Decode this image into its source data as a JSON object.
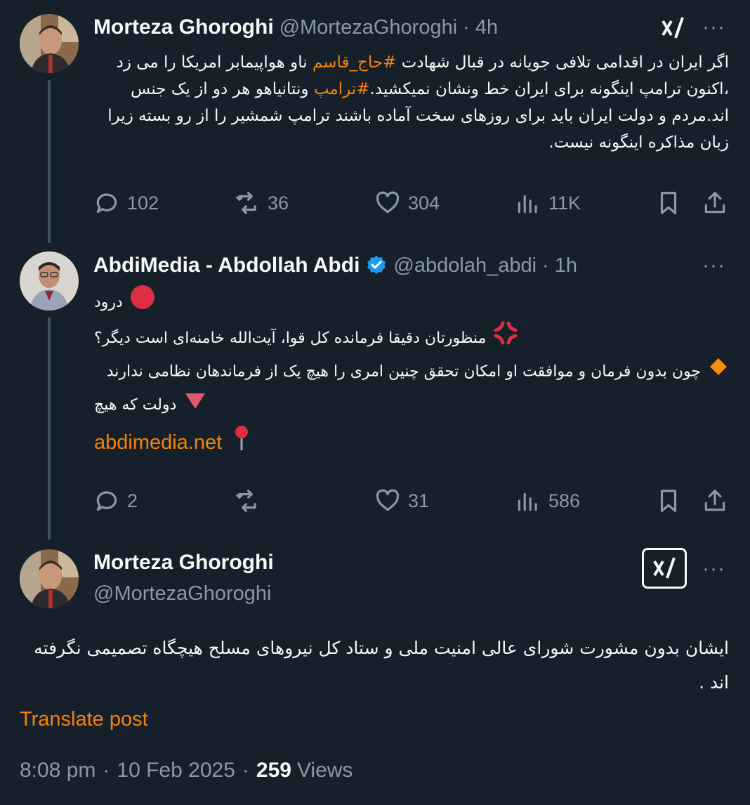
{
  "tweet1": {
    "name": "Morteza Ghoroghi",
    "handle": "@MortezaGhoroghi",
    "time": "4h",
    "text_a": "اگر ایران در اقدامی تلافی جویانه در قبال شهادت ",
    "hashtag_a": "#حاج_قاسم",
    "text_b": " ناو هواپیمابر امریکا را می زد ،اکنون ترامپ اینگونه برای ایران خط ونشان نمیکشید.",
    "hashtag_b": "#ترامپ",
    "text_c": " ونتانیاهو هر دو از یک جنس اند.مردم و دولت ایران باید برای روزهای سخت آماده باشند ترامپ شمشیر را از رو بسته زیرا زبان مذاکره اینگونه نیست.",
    "stats": {
      "replies": "102",
      "reposts": "36",
      "likes": "304",
      "views": "11K"
    }
  },
  "tweet2": {
    "name": "AbdiMedia - Abdollah Abdi",
    "handle": "@abdolah_abdi",
    "time": "1h",
    "line1": "درود",
    "line2": "منظورتان دقیقا فرمانده کل قوا، آیت‌الله خامنه‌ای است دیگر؟",
    "line3": "چون بدون فرمان و موافقت او امکان تحقق چنین امری را هیچ یک از فرماندهان نظامی ندارند",
    "line4": "دولت که هیچ",
    "link": "abdimedia.net",
    "stats": {
      "replies": "2",
      "reposts": "",
      "likes": "31",
      "views": "586"
    }
  },
  "tweet3": {
    "name": "Morteza Ghoroghi",
    "handle": "@MortezaGhoroghi",
    "text": "ایشان بدون مشورت شورای عالی امنیت ملی و ستاد کل نیروهای مسلح هیچگاه تصمیمی نگرفته اند .",
    "translate": "Translate post",
    "time": "8:08 pm",
    "date": "10 Feb 2025",
    "views_count": "259",
    "views_label": "Views"
  },
  "separator": "·",
  "more": "···",
  "colors": {
    "background": "#15202b",
    "accent": "#f4820a",
    "muted": "#8b98a5",
    "text": "#f7f9f9",
    "verified": "#1d9bf0"
  },
  "icons": [
    "reply-icon",
    "repost-icon",
    "like-icon",
    "views-icon",
    "bookmark-icon",
    "share-icon",
    "grok-icon",
    "more-icon",
    "verified-badge-icon"
  ]
}
